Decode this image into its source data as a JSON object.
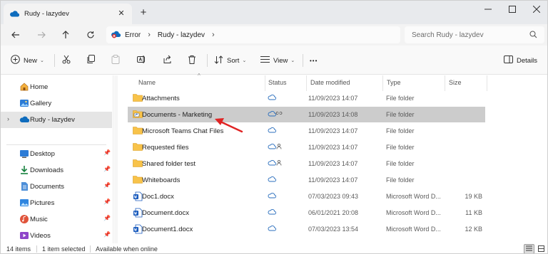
{
  "window": {
    "tab_title": "Rudy - lazydev",
    "new_tab": "+"
  },
  "address": {
    "crumbs": [
      "Error",
      "Rudy - lazydev"
    ],
    "search_placeholder": "Search Rudy - lazydev"
  },
  "toolbar": {
    "new_label": "New",
    "sort_label": "Sort",
    "view_label": "View",
    "more_label": "•••",
    "details_label": "Details"
  },
  "sidebar": {
    "items": [
      {
        "label": "Home",
        "icon": "home-icon"
      },
      {
        "label": "Gallery",
        "icon": "gallery-icon"
      },
      {
        "label": "Rudy - lazydev",
        "icon": "cloud-icon",
        "selected": true
      },
      {
        "label": "Desktop",
        "icon": "desktop-icon",
        "pinned": true
      },
      {
        "label": "Downloads",
        "icon": "download-icon",
        "pinned": true
      },
      {
        "label": "Documents",
        "icon": "documents-icon",
        "pinned": true
      },
      {
        "label": "Pictures",
        "icon": "pictures-icon",
        "pinned": true
      },
      {
        "label": "Music",
        "icon": "music-icon",
        "pinned": true
      },
      {
        "label": "Videos",
        "icon": "videos-icon",
        "pinned": true
      }
    ]
  },
  "columns": {
    "name": "Name",
    "status": "Status",
    "date": "Date modified",
    "type": "Type",
    "size": "Size"
  },
  "files": [
    {
      "name": "Attachments",
      "kind": "folder",
      "status": "cloud",
      "date": "11/09/2023 14:07",
      "type": "File folder",
      "size": ""
    },
    {
      "name": "Documents - Marketing",
      "kind": "shortcut-folder",
      "status": "cloud-link",
      "date": "11/09/2023 14:08",
      "type": "File folder",
      "size": "",
      "selected": true
    },
    {
      "name": "Microsoft Teams Chat Files",
      "kind": "folder",
      "status": "cloud",
      "date": "11/09/2023 14:07",
      "type": "File folder",
      "size": ""
    },
    {
      "name": "Requested files",
      "kind": "folder",
      "status": "cloud-shared",
      "date": "11/09/2023 14:07",
      "type": "File folder",
      "size": ""
    },
    {
      "name": "Shared folder test",
      "kind": "folder",
      "status": "cloud-shared",
      "date": "11/09/2023 14:07",
      "type": "File folder",
      "size": ""
    },
    {
      "name": "Whiteboards",
      "kind": "folder",
      "status": "cloud",
      "date": "11/09/2023 14:07",
      "type": "File folder",
      "size": ""
    },
    {
      "name": "Doc1.docx",
      "kind": "word",
      "status": "cloud",
      "date": "07/03/2023 09:43",
      "type": "Microsoft Word D...",
      "size": "19 KB"
    },
    {
      "name": "Document.docx",
      "kind": "word",
      "status": "cloud",
      "date": "06/01/2021 20:08",
      "type": "Microsoft Word D...",
      "size": "11 KB"
    },
    {
      "name": "Document1.docx",
      "kind": "word",
      "status": "cloud",
      "date": "07/03/2023 13:54",
      "type": "Microsoft Word D...",
      "size": "12 KB"
    }
  ],
  "status_bar": {
    "item_count": "14 items",
    "selection": "1 item selected",
    "availability": "Available when online"
  },
  "colors": {
    "accent": "#0f6cbd",
    "folder": "#f8c34a",
    "word": "#185abd",
    "annotation": "#e02424"
  }
}
